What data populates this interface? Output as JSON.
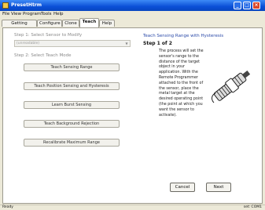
{
  "window": {
    "title": "PresetHtrm"
  },
  "menu": [
    "File",
    "View",
    "Program",
    "Tools",
    "Help"
  ],
  "tabs": [
    "Getting Started",
    "Configure",
    "Clone",
    "Teach",
    "Help"
  ],
  "active_tab": "Teach",
  "left": {
    "step1_label": "Step 1: Select Sensor to Modify",
    "sensor_select_value": "(unreadable)",
    "step2_label": "Step 2: Select Teach Mode",
    "buttons": [
      "Teach Sensing Range",
      "Teach Position Sensing and Hysteresis",
      "Learn Burst Sensing",
      "Teach Background Rejection",
      "Recalibrate Maximum Range"
    ]
  },
  "right": {
    "title": "Teach Sensing Range with Hysteresis",
    "step": "Step 1 of 2",
    "instructions": "The process will set the sensor's range to the distance of the target object in your application. With the Remote Programmer attached to the front of the sensor, place the metal target at the desired operating point (the point at which you want the sensor to activate).",
    "cancel_label": "Cancel",
    "next_label": "Next"
  },
  "status": {
    "left": "Ready",
    "right": "set: COM1"
  },
  "colors": {
    "accent": "#0a4fd6",
    "close": "#d9472b",
    "chrome": "#ece9d8"
  },
  "icons": {
    "minimize": "minimize-icon",
    "maximize": "maximize-icon",
    "close": "close-icon"
  }
}
